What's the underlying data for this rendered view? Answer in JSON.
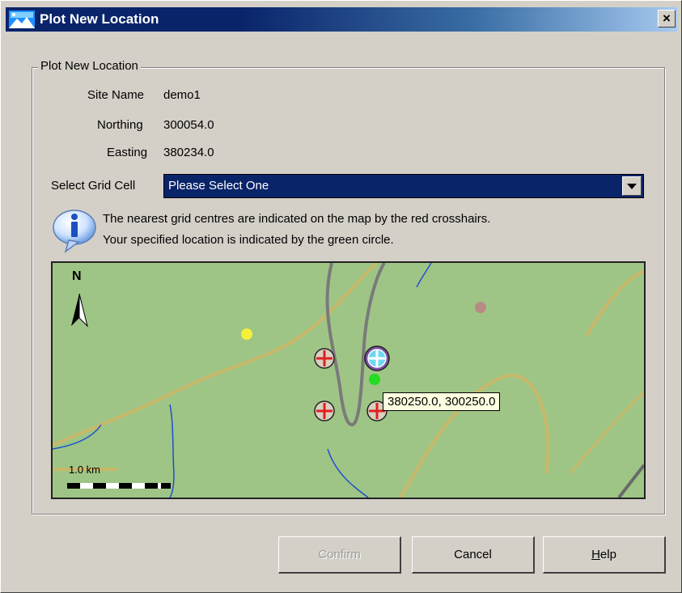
{
  "window": {
    "title": "Plot New Location",
    "close_symbol": "×"
  },
  "group": {
    "title": "Plot New Location"
  },
  "fields": {
    "site_name_label": "Site Name",
    "site_name_value": "demo1",
    "northing_label": "Northing",
    "northing_value": "300054.0",
    "easting_label": "Easting",
    "easting_value": "380234.0"
  },
  "grid_select": {
    "label": "Select Grid Cell",
    "selected": "Please Select One",
    "icon": "chevron-down-icon"
  },
  "info": {
    "icon": "info-icon",
    "line1": "The nearest grid centres are indicated on the map by the red crosshairs.",
    "line2": "Your specified location is indicated by the green circle."
  },
  "map": {
    "north_label": "N",
    "tooltip": "380250.0, 300250.0",
    "scale_label": "1.0 km",
    "colors": {
      "land": "#9ec585",
      "river": "#1f4fd0",
      "road": "#c9b86a",
      "track": "#7a7a7a",
      "crosshair": "#e02020",
      "location": "#22dd22"
    }
  },
  "buttons": {
    "confirm": "Confirm",
    "cancel": "Cancel",
    "help": "Help"
  }
}
